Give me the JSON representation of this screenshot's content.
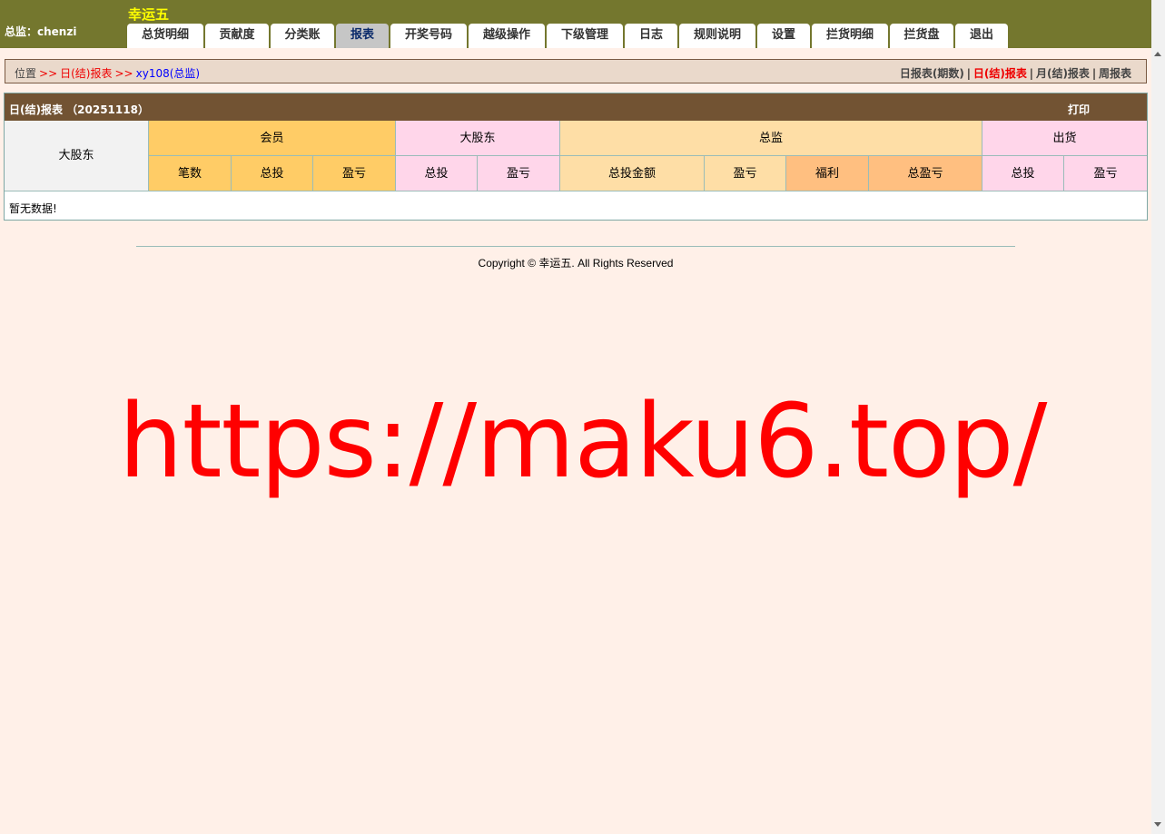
{
  "header": {
    "user_role_label": "总监：",
    "username": "chenzi",
    "app_title": "幸运五"
  },
  "nav": {
    "tabs": [
      {
        "label": "总货明细",
        "active": false
      },
      {
        "label": "贡献度",
        "active": false
      },
      {
        "label": "分类账",
        "active": false
      },
      {
        "label": "报表",
        "active": true
      },
      {
        "label": "开奖号码",
        "active": false
      },
      {
        "label": "越级操作",
        "active": false
      },
      {
        "label": "下级管理",
        "active": false
      },
      {
        "label": "日志",
        "active": false
      },
      {
        "label": "规则说明",
        "active": false
      },
      {
        "label": "设置",
        "active": false
      },
      {
        "label": "拦货明细",
        "active": false
      },
      {
        "label": "拦货盘",
        "active": false
      },
      {
        "label": "退出",
        "active": false
      }
    ]
  },
  "breadcrumb": {
    "position_label": "位置",
    "separator": ">>",
    "level1": "日(结)报表",
    "level2": "xy108(总监)"
  },
  "report_links": {
    "period": "日报表(期数)",
    "daily": "日(结)报表",
    "monthly": "月(结)报表",
    "weekly": "周报表",
    "divider": "|"
  },
  "report": {
    "title": "日(结)报表 （20251118）",
    "print_label": "打印",
    "col_main": "大股东",
    "groups": {
      "member": "会员",
      "major": "大股东",
      "director": "总监",
      "outgoing": "出货"
    },
    "subheaders": {
      "member_count": "笔数",
      "member_total": "总投",
      "member_pl": "盈亏",
      "major_total": "总投",
      "major_pl": "盈亏",
      "director_amount": "总投金额",
      "director_pl": "盈亏",
      "director_welfare": "福利",
      "director_total_pl": "总盈亏",
      "outgoing_total": "总投",
      "outgoing_pl": "盈亏"
    },
    "empty_text": "暂无数据!"
  },
  "footer": {
    "copyright": "Copyright © 幸运五. All Rights Reserved"
  },
  "watermark": {
    "text": "https://maku6.top/"
  },
  "colors": {
    "topbar": "#74772e",
    "title_yellow": "#ffff00",
    "report_header": "#725333",
    "gold": "#ffcc66",
    "pink": "#ffd6ea",
    "tan": "#fedea6",
    "orange": "#ffbf80",
    "page_bg": "#fff0e8",
    "watermark_red": "#ff0000"
  }
}
